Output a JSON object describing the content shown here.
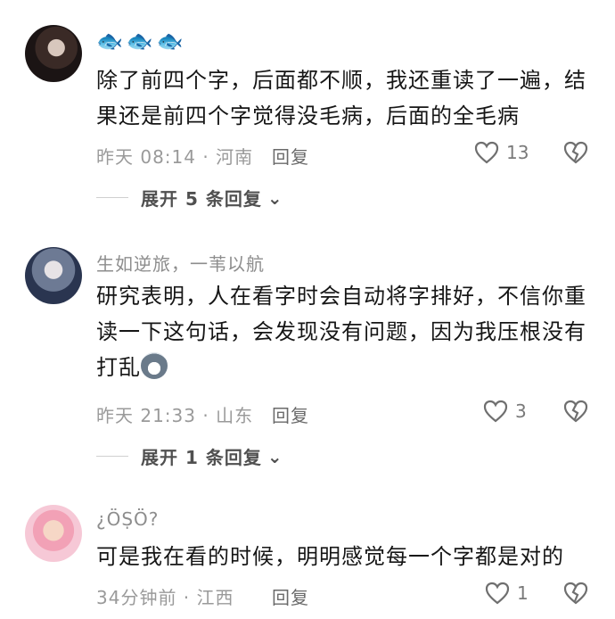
{
  "comments": [
    {
      "author": "🐟🐟🐟",
      "text": "除了前四个字，后面都不顺，我还重读了一遍，结果还是前四个字觉得没毛病，后面的全毛病",
      "meta": "昨天 08:14 · 河南",
      "reply_label": "回复",
      "likes": "13",
      "expand_label": "展开 5 条回复"
    },
    {
      "author": "生如逆旅，一苇以航",
      "text": "研究表明，人在看字时会自动将字排好，不信你重读一下这句话，会发现没有问题，因为我压根没有打乱",
      "meta": "昨天 21:33 · 山东",
      "reply_label": "回复",
      "likes": "3",
      "expand_label": "展开 1 条回复"
    },
    {
      "author": "¿ÖṢÖ?",
      "text": "可是我在看的时候，明明感觉每一个字都是对的",
      "meta": "34分钟前 · 江西",
      "reply_label": "回复",
      "likes": "1"
    }
  ]
}
